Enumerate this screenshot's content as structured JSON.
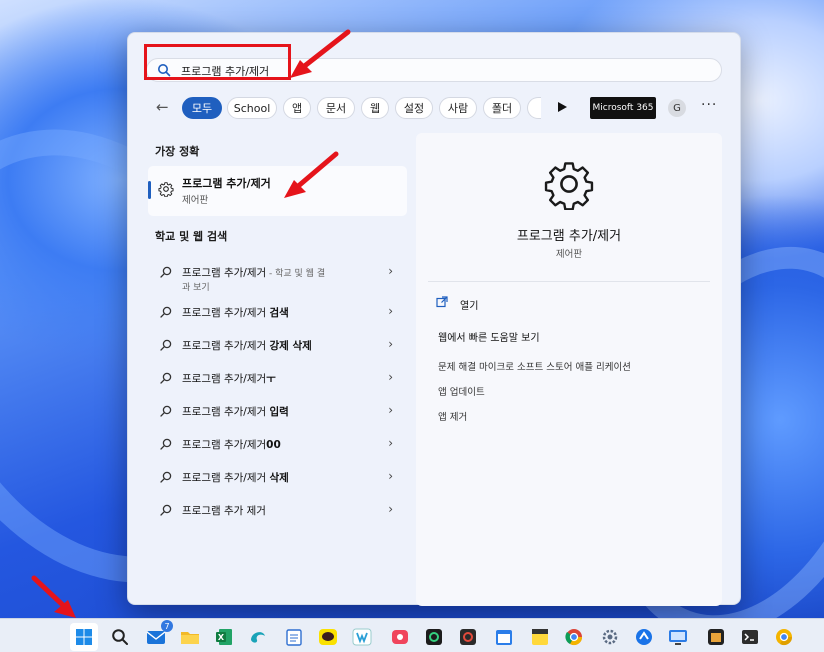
{
  "search": {
    "query": "프로그램 추가/제거"
  },
  "filters": {
    "back": "←",
    "chips": [
      "모두",
      "School",
      "앱",
      "문서",
      "웹",
      "설정",
      "사람",
      "폴더"
    ],
    "ms365": "Microsoft 365",
    "avatar": "G",
    "more": "···"
  },
  "best_match": {
    "section": "가장 정확",
    "title": "프로그램 추가/제거",
    "subtitle": "제어판"
  },
  "web_search": {
    "section": "학교 및 웹 검색",
    "rows": [
      {
        "prefix": "프로그램 추가/제거",
        "bold": "",
        "suffix": " - 학교 및 웹 결",
        "line2": "과 보기"
      },
      {
        "prefix": "프로그램 추가/제거 ",
        "bold": "검색",
        "suffix": "",
        "line2": ""
      },
      {
        "prefix": "프로그램 추가/제거 ",
        "bold": "강제 삭제",
        "suffix": "",
        "line2": ""
      },
      {
        "prefix": "프로그램 추가/제거",
        "bold": "ㅜ",
        "suffix": "",
        "line2": ""
      },
      {
        "prefix": "프로그램 추가/제거 ",
        "bold": "입력",
        "suffix": "",
        "line2": ""
      },
      {
        "prefix": "프로그램 추가/제거",
        "bold": "00",
        "suffix": "",
        "line2": ""
      },
      {
        "prefix": "프로그램 추가/제거 ",
        "bold": "삭제",
        "suffix": "",
        "line2": ""
      },
      {
        "prefix": "프로그램 추가 제거",
        "bold": "",
        "suffix": "",
        "line2": ""
      }
    ]
  },
  "detail": {
    "title": "프로그램 추가/제거",
    "subtitle": "제어판",
    "open_label": "열기",
    "web_heading": "웹에서 빠른 도움말 보기",
    "links": [
      "문제 해결 마이크로 소프트 스토어 애플 리케이션",
      "앱 업데이트",
      "앱 제거"
    ]
  },
  "colors": {
    "accent": "#1f5fbf",
    "annotation_red": "#e5141b"
  },
  "taskbar": {
    "items": [
      "start-icon",
      "search-icon",
      "mail-icon",
      "file-explorer-icon",
      "excel-icon",
      "edge-app-icon",
      "notepad-icon",
      "kakaotalk-icon",
      "vmware-icon",
      "screen-recorder-icon",
      "terminal-green-icon",
      "camera-app-icon",
      "calendar-icon",
      "sticky-notes-icon",
      "chrome-icon",
      "settings-gear-icon",
      "remote-icon",
      "monitor-icon",
      "game-icon",
      "terminal-icon",
      "chrome-canary-icon"
    ],
    "mail_badge": "7"
  }
}
